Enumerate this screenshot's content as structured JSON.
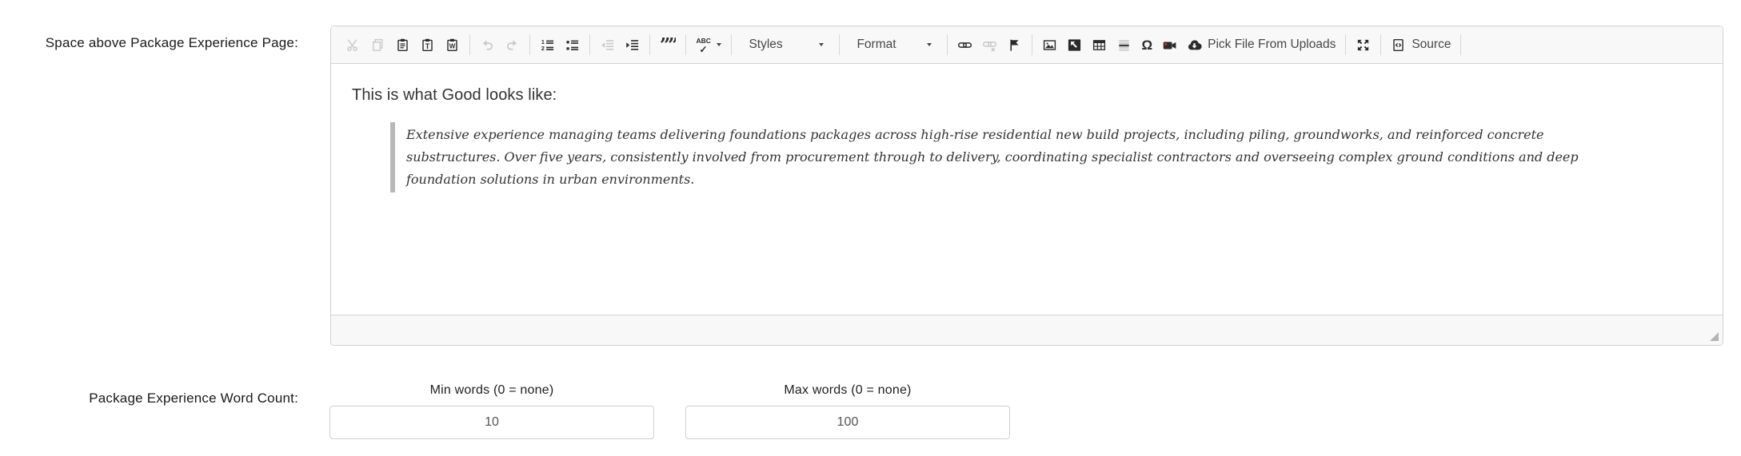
{
  "form": {
    "editor_label": "Space above Package Experience Page:",
    "word_count_label": "Package Experience Word Count:"
  },
  "editor": {
    "toolbar": {
      "styles_label": "Styles",
      "format_label": "Format",
      "pick_file_label": "Pick File From Uploads",
      "source_label": "Source",
      "omega_glyph": "Ω",
      "quote_glyph": "””",
      "spellcheck_glyph": "ABC",
      "spellcheck_check_glyph": "✓",
      "icon_names": [
        "cut",
        "copy",
        "paste",
        "paste-plain-text",
        "paste-from-word",
        "undo",
        "redo",
        "numbered-list",
        "bulleted-list",
        "decrease-indent",
        "increase-indent",
        "blockquote",
        "spellcheck",
        "link",
        "unlink",
        "anchor-flag",
        "image",
        "enhanced-image",
        "table",
        "horizontal-rule",
        "special-character",
        "video",
        "cloud-upload",
        "maximize",
        "source-code"
      ]
    },
    "content": {
      "heading": "This is what Good looks like:",
      "quote": "Extensive experience managing teams delivering foundations packages across high-rise residential new build projects, including piling, groundworks, and reinforced concrete substructures. Over five years, consistently involved from procurement through to delivery, coordinating specialist contractors and overseeing complex ground conditions and deep foundation solutions in urban environments."
    }
  },
  "word_count": {
    "min_label": "Min words (0 = none)",
    "min_value": "10",
    "max_label": "Max words (0 = none)",
    "max_value": "100"
  },
  "colors": {
    "editor_border": "#d1d1d1",
    "toolbar_bg": "#f8f8f8",
    "icon_enabled": "#2b2b2b",
    "icon_disabled": "#c9c9c9",
    "toolbar_text": "#474747",
    "blockquote_bar": "#b8b8b8",
    "video_accent": "#cc2b2b"
  }
}
